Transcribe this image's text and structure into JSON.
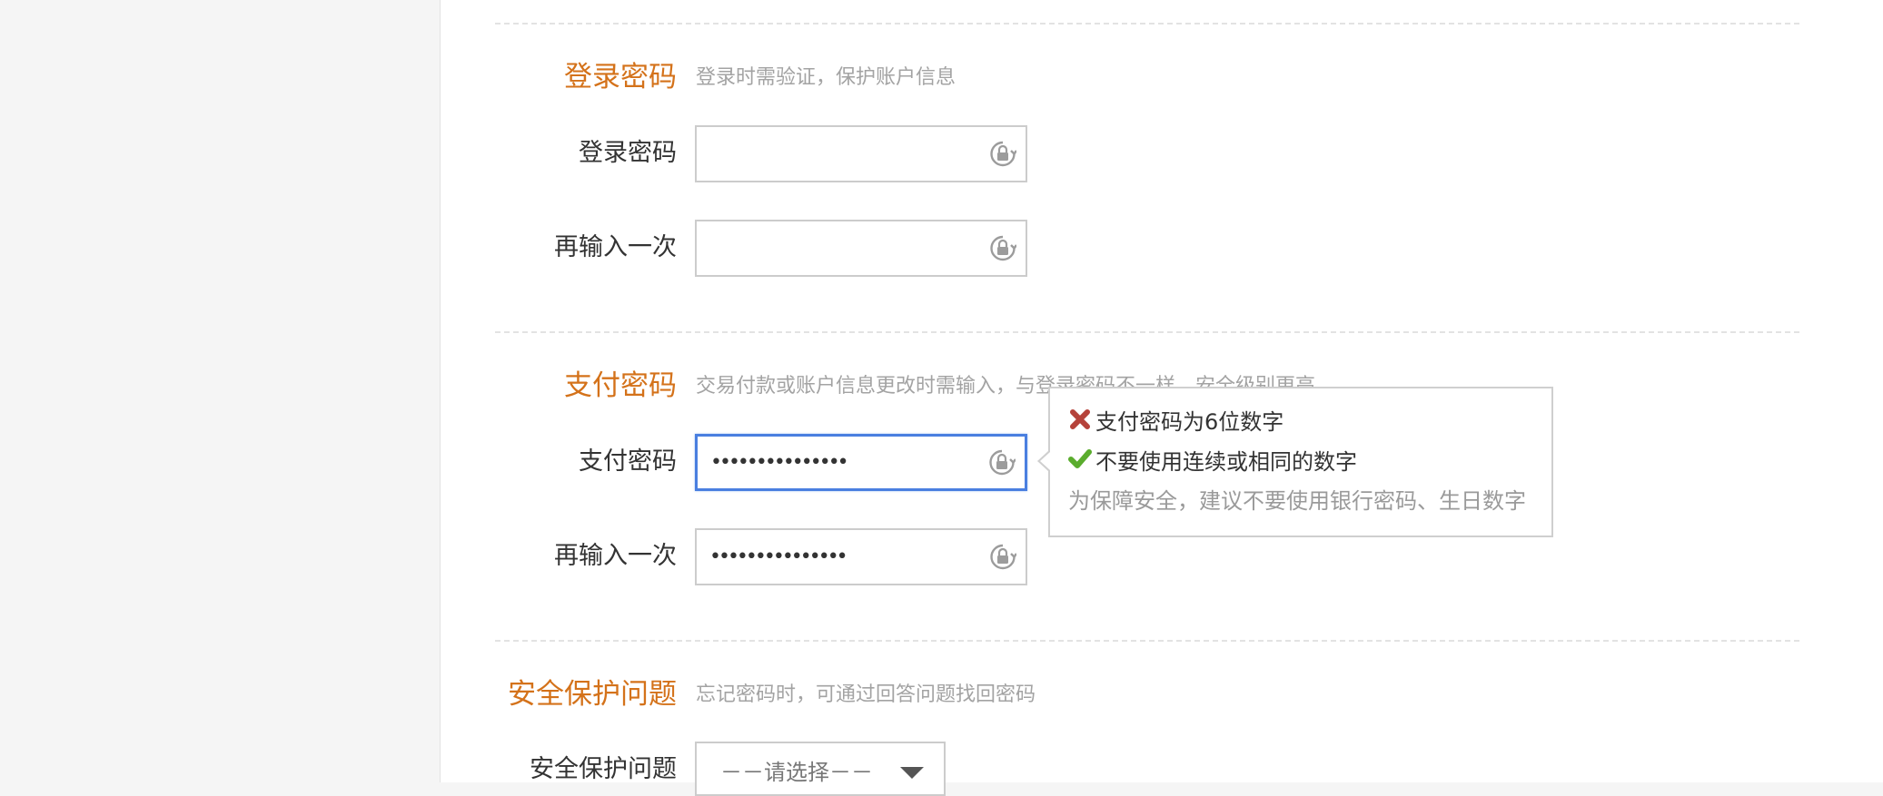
{
  "login_password": {
    "section_title": "登录密码",
    "section_desc": "登录时需验证，保护账户信息",
    "field_label": "登录密码",
    "confirm_label": "再输入一次",
    "value": "",
    "confirm_value": ""
  },
  "pay_password": {
    "section_title": "支付密码",
    "section_desc": "交易付款或账户信息更改时需输入，与登录密码不一样，安全级别更高",
    "field_label": "支付密码",
    "confirm_label": "再输入一次",
    "value": "•••••••••••••••",
    "confirm_value": "•••••••••••••••"
  },
  "pay_password_tip": {
    "rule_length": "支付密码为6位数字",
    "rule_length_status": "fail",
    "rule_sequence": "不要使用连续或相同的数字",
    "rule_sequence_status": "pass",
    "note": "为保障安全，建议不要使用银行密码、生日数字"
  },
  "security_question": {
    "section_title": "安全保护问题",
    "section_desc": "忘记密码时，可通过回答问题找回密码",
    "field_label": "安全保护问题",
    "select_value": "－－请选择－－"
  },
  "colors": {
    "section_title": "#d4721a",
    "focus_border": "#4a7fe0",
    "fail_icon": "#b5423a",
    "pass_icon": "#5aac2d"
  },
  "icons": {
    "password_toggle": "lock-icon",
    "rule_fail": "cross-icon",
    "rule_pass": "check-icon",
    "select_toggle": "chevron-down-icon"
  }
}
